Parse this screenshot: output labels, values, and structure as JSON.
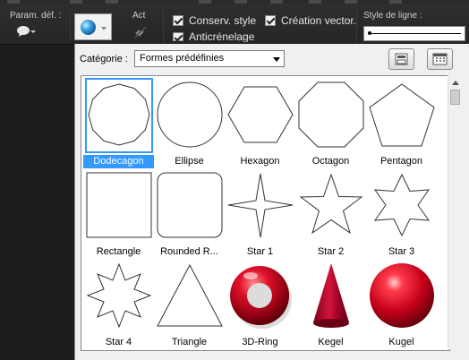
{
  "toolbar": {
    "param_label": "Param. déf. :",
    "act_label": "Act",
    "conserv_style_label": "Conserv. style",
    "creation_vector_label": "Création vector.",
    "anticrenelage_label": "Anticrénelage",
    "line_style_label": "Style de ligne :"
  },
  "popup": {
    "category_label": "Catégorie :",
    "category_value": "Formes prédéfinies"
  },
  "gallery": {
    "selected_index": 0,
    "items": [
      {
        "label": "Dodecagon",
        "icon": "dodecagon-icon"
      },
      {
        "label": "Ellipse",
        "icon": "ellipse-icon"
      },
      {
        "label": "Hexagon",
        "icon": "hexagon-icon"
      },
      {
        "label": "Octagon",
        "icon": "octagon-icon"
      },
      {
        "label": "Pentagon",
        "icon": "pentagon-icon"
      },
      {
        "label": "Rectangle",
        "icon": "rectangle-icon"
      },
      {
        "label": "Rounded R...",
        "icon": "rounded-rectangle-icon"
      },
      {
        "label": "Star 1",
        "icon": "star-4-point-icon"
      },
      {
        "label": "Star 2",
        "icon": "star-5-point-icon"
      },
      {
        "label": "Star 3",
        "icon": "star-6-point-icon"
      },
      {
        "label": "Star 4",
        "icon": "star-8-point-icon"
      },
      {
        "label": "Triangle",
        "icon": "triangle-icon"
      },
      {
        "label": "3D-Ring",
        "icon": "3d-ring-icon"
      },
      {
        "label": "Kegel",
        "icon": "cone-icon"
      },
      {
        "label": "Kugel",
        "icon": "sphere-icon"
      }
    ]
  },
  "colors": {
    "selection": "#3399ff",
    "toolbar_bg": "#2a2a2a",
    "popup_bg": "#f0f0f0",
    "shape_3d_red": "#c4001a"
  }
}
